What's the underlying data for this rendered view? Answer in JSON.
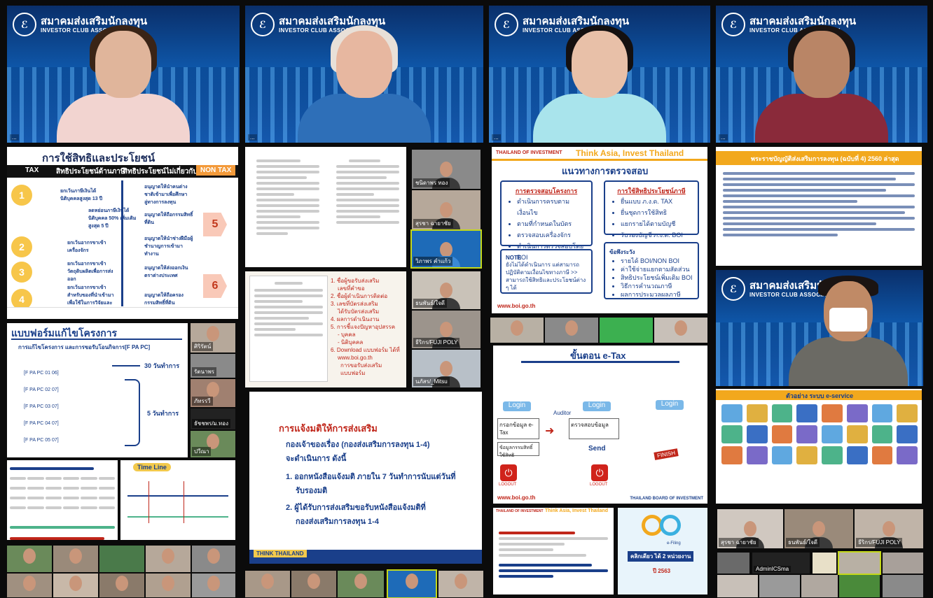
{
  "brand": {
    "thai": "สมาคมส่งเสริมนักลงทุน",
    "en": "INVESTOR CLUB ASSOCIATION"
  },
  "video_tiles": [
    {
      "name": "speaker-1",
      "tag": "..."
    },
    {
      "name": "speaker-2",
      "tag": "..."
    },
    {
      "name": "speaker-3",
      "tag": "..."
    },
    {
      "name": "speaker-4",
      "tag": "..."
    },
    {
      "name": "speaker-5",
      "tag": ""
    }
  ],
  "slide_benefits": {
    "title": "การใช้สิทธิและประโยชน์",
    "tax_label": "TAX",
    "tax_col": "สิทธิประโยชน์ด้านภาษี",
    "nontax_col": "สิทธิประโยชน์ไม่เกี่ยวกับภาษี",
    "nontax_label": "NON TAX",
    "rows": [
      {
        "n": "1",
        "left": "ยกเว้นภาษีเงินได้นิติบุคคลสูงสุด 13 ปี",
        "right": "อนุญาตให้นำคนต่างชาติเข้ามาเพื่อศึกษาลู่ทางการลงทุน"
      },
      {
        "n": "",
        "left": "ลดหย่อนภาษีเงินได้นิติบุคคล 50% เพิ่มเติมสูงสุด 5 ปี",
        "right": "อนุญาตให้ถือกรรมสิทธิ์ที่ดิน"
      },
      {
        "n": "2",
        "left": "ยกเว้นอากรขาเข้าเครื่องจักร",
        "right": "อนุญาตให้นำช่างฝีมือผู้ชำนาญการเข้ามาทำงาน"
      },
      {
        "n": "3",
        "left": "ยกเว้นอากรขาเข้าวัตถุดิบผลิตเพื่อการส่งออก",
        "right": "อนุญาตให้ส่งออกเงินตราต่างประเทศ"
      },
      {
        "n": "4",
        "left": "ยกเว้นอากรขาเข้าสำหรับของที่นำเข้ามาเพื่อใช้ในการวิจัยและพัฒนา",
        "right": "อนุญาตให้ถือครองกรรมสิทธิ์ที่ดิน"
      }
    ],
    "side_nums": [
      "5",
      "6"
    ]
  },
  "slide_forms": {
    "title": "แบบฟอร์มแก้ไขโครงการ",
    "subtitle": "การแก้ไขโครงการ และการขอรับโอนกิจการ[F PA PC]",
    "items": [
      "[F PA PC 01 06]",
      "[F PA PC 02 07]",
      "[F PA PC 03 07]",
      "[F PA PC 04 07]",
      "[F PA PC 05 07]"
    ],
    "days_a": "30 วันทำการ",
    "days_b": "5 วันทำการ"
  },
  "slide_notify": {
    "title": "การแจ้งมติให้การส่งเสริม",
    "line1": "กองเจ้าของเรื่อง (กองส่งเสริมการลงทุน 1-4)",
    "line2": "จะดำเนินการ   ดังนี้",
    "step1": "1. ออกหนังสือแจ้งมติ  ภายใน 7 วันทำการนับแต่วันที่",
    "step1b": "รับรองมติ",
    "step2": "2. ผู้ได้รับการส่งเสริมขอรับหนังสือแจ้งมติที่",
    "step2b": "กองส่งเสริมการลงทุน 1-4",
    "footer": "THINK THAILAND"
  },
  "slide_list": {
    "items": [
      "1. ชื่อผู้ขอรับส่งเสริม",
      "เลขที่คำขอ",
      "2. ชื่อผู้ดำเนินการติดต่อ",
      "3. เลขที่บัตรส่งเสริม",
      "ได้รับบัตรส่งเสริม",
      "4. ผลการดำเนินงาน",
      "5. การชี้แจงปัญหาอุปสรรค",
      "- บุคคล",
      "- นิติบุคคล",
      "6. Download แบบฟอร์ม ได้ที่",
      "www.boi.go.th",
      "การขอรับส่งเสริม",
      "แบบฟอร์ม"
    ]
  },
  "slide_audit": {
    "brand_left": "THAILAND OF INVESTMENT",
    "brand_right": "Think Asia, Invest Thailand",
    "title": "แนวทางการตรวจสอบ",
    "box1_title": "การตรวจสอบโครงการ",
    "box1": [
      "ดำเนินการครบตามเงื่อนไข",
      "ตามที่กำหนดในบัตร",
      "ตรวจสอบเครื่องจักร",
      "ดำเนินการตรวจสอบโดย BOI"
    ],
    "box2_title": "การใช้สิทธิประโยชน์ภาษี",
    "box2": [
      "ยื่นแบบ ภ.ง.ด. TAX",
      "ยื่นชุดการใช้สิทธิ",
      "แยกรายได้ตามบัญชี",
      "รับรองบัญชี ภ.ง.ด. BOI"
    ],
    "note_title": "NOTE",
    "note": "ยังไม่ได้ดำเนินการ แต่สามารถปฏิบัติตามเงื่อนไขทางภาษี >> สามารถใช้สิทธิและประโยชน์ต่าง ๆ ได้",
    "box3_title": "ข้อพึงระวัง",
    "box3": [
      "รายได้ BOI/NON BOI",
      "ค่าใช้จ่ายแยกตามสัดส่วน",
      "สิทธิประโยชน์เพิ่มเติม BOI",
      "วิธีการคำนวณภาษี",
      "ผลการประมวลผลภาษี"
    ],
    "url": "www.boi.go.th"
  },
  "slide_law": {
    "title": "พระราชบัญญัติส่งเสริมการลงทุน (ฉบับที่ 4) 2560 ล่าสุด",
    "lines": 12
  },
  "slide_etax": {
    "title": "ขั้นตอน e-Tax",
    "login": "Login",
    "auditor": "Auditor",
    "box1": "กรอกข้อมูล e-Tax",
    "box2": "ข้อมูลกรรมสิทธิ์ใช้สิทธิ",
    "box3": "ตรวจสอบข้อมูล",
    "send": "Send",
    "logout": "LOGOUT",
    "finish": "FINISH",
    "url": "www.boi.go.th",
    "footer": "THAILAND BOARD OF INVESTMENT"
  },
  "slide_eservice": {
    "title": "ตัวอย่าง ระบบ e-service"
  },
  "slide_timeline": {
    "title": "Time Line"
  },
  "slide_eform": {
    "brand_left": "THAILAND OF INVESTMENT",
    "brand_right": "Think Asia, Invest Thailand"
  },
  "slide_efiling": {
    "caption": "คลิกเดียว ได้ 2 หน่วยงาน",
    "logo": "e-Filing",
    "year": "ปี 2563"
  },
  "thumbs": [
    {
      "tag": "ชนิดาพร ทอง"
    },
    {
      "tag": "สุรชา ฉายาชัย"
    },
    {
      "tag": "วิภาพร คำแก้ว"
    },
    {
      "tag": "ธนพันธ์/ใจดี"
    },
    {
      "tag": "ธีริกร/FUJI POLY"
    },
    {
      "tag": "นภัสร/_Mitsu"
    },
    {
      "tag": "ศิริรัตน์"
    },
    {
      "tag": "รัตนาพร"
    },
    {
      "tag": "ภัทรรวี"
    },
    {
      "tag": "ธัชชพร/ม.ทอง"
    },
    {
      "tag": "ปวีณา"
    },
    {
      "tag": "สุรชา ฉายาชัย"
    },
    {
      "tag": "ธนพันธ์/ใจดี"
    },
    {
      "tag": "ธีริกร/FUJI POLY"
    },
    {
      "tag": "AdminICSma"
    }
  ]
}
